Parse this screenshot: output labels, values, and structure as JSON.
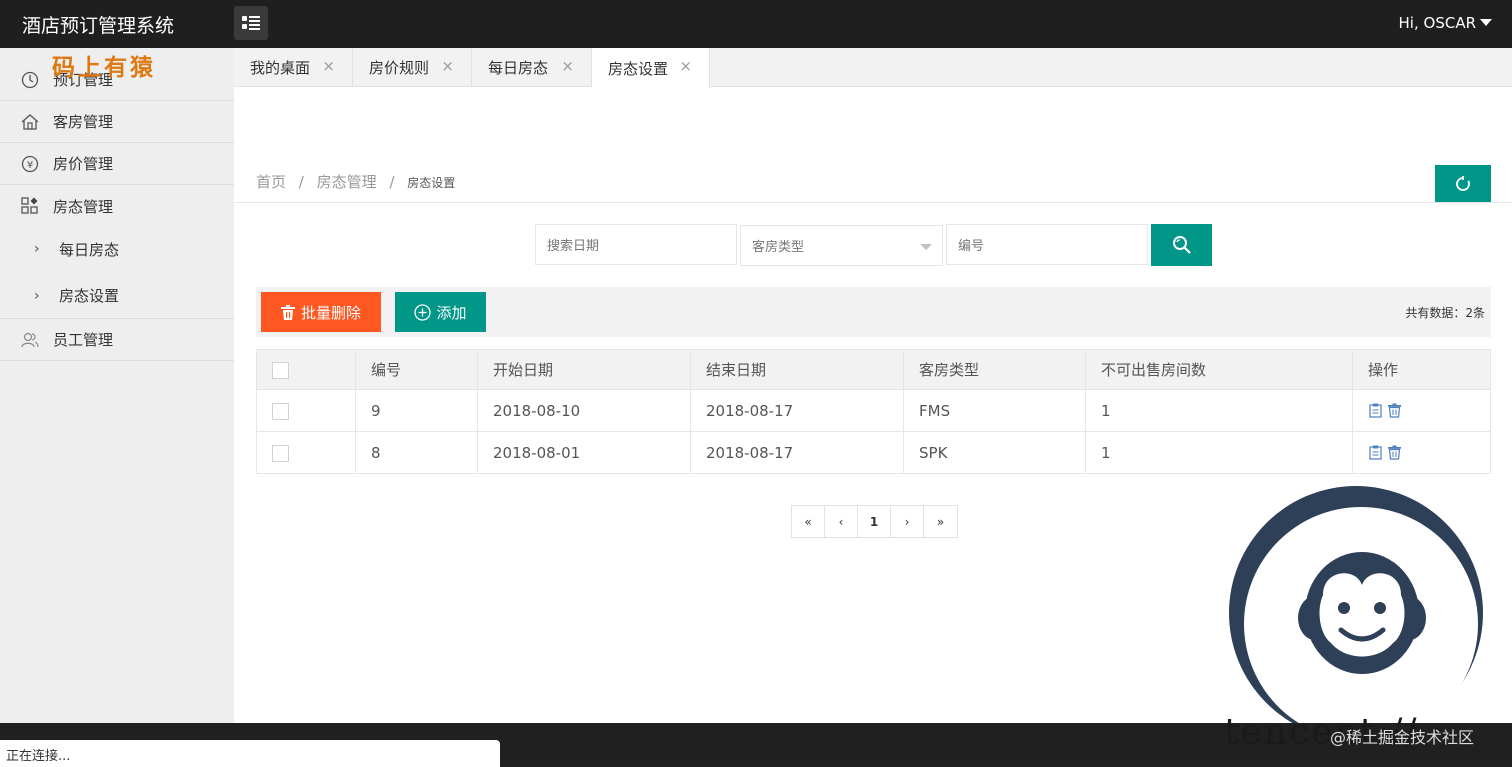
{
  "header": {
    "app_title": "酒店预订管理系统",
    "user_greeting": "Hi, OSCAR"
  },
  "watermark": {
    "top_left": "码上有猿",
    "tencent": "tencent://",
    "juejin": "@稀土掘金技术社区"
  },
  "sidebar": {
    "items": [
      {
        "label": "预订管理",
        "icon": "clock-icon"
      },
      {
        "label": "客房管理",
        "icon": "home-icon"
      },
      {
        "label": "房价管理",
        "icon": "yen-icon"
      },
      {
        "label": "房态管理",
        "icon": "apps-icon"
      },
      {
        "label": "员工管理",
        "icon": "users-icon"
      }
    ],
    "sub_items": [
      {
        "label": "每日房态"
      },
      {
        "label": "房态设置"
      }
    ]
  },
  "tabs": [
    {
      "label": "我的桌面"
    },
    {
      "label": "房价规则"
    },
    {
      "label": "每日房态"
    },
    {
      "label": "房态设置",
      "active": true
    }
  ],
  "breadcrumb": {
    "home": "首页",
    "sep": "/",
    "section": "房态管理",
    "current": "房态设置"
  },
  "search": {
    "date_placeholder": "搜索日期",
    "room_type_selected": "客房类型",
    "number_placeholder": "编号"
  },
  "toolbar": {
    "batch_delete": "批量删除",
    "add": "添加",
    "total": "共有数据：2条"
  },
  "table": {
    "headers": [
      "编号",
      "开始日期",
      "结束日期",
      "客房类型",
      "不可出售房间数",
      "操作"
    ],
    "rows": [
      {
        "id": "9",
        "start": "2018-08-10",
        "end": "2018-08-17",
        "type": "FMS",
        "count": "1"
      },
      {
        "id": "8",
        "start": "2018-08-01",
        "end": "2018-08-17",
        "type": "SPK",
        "count": "1"
      }
    ]
  },
  "pagination": {
    "first": "«",
    "prev": "‹",
    "current": "1",
    "next": "›",
    "last": "»"
  },
  "status_bar": {
    "text": "正在连接..."
  },
  "colors": {
    "primary": "#009688",
    "danger": "#ff5722",
    "topbar": "#1f1f1f",
    "sidebar": "#eeeeee"
  }
}
